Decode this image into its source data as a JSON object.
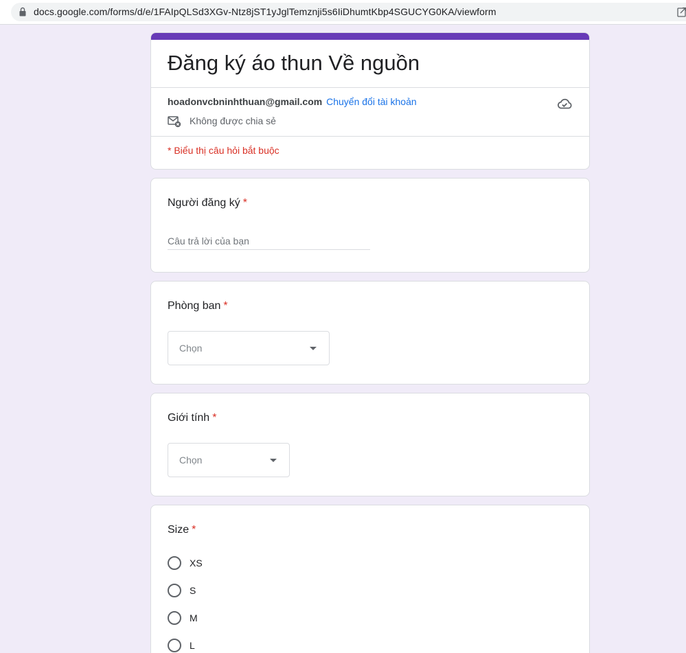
{
  "browser": {
    "url": "docs.google.com/forms/d/e/1FAIpQLSd3XGv-Ntz8jST1yJglTemznji5s6IiDhumtKbp4SGUCYG0KA/viewform",
    "lock_icon": "lock-icon",
    "share_icon": "share-icon"
  },
  "colors": {
    "accent": "#673ab7",
    "background": "#f0ebf8",
    "required": "#d93025",
    "link": "#1a73e8"
  },
  "header": {
    "title": "Đăng ký áo thun Về nguồn",
    "account_email": "hoadonvcbninhthuan@gmail.com",
    "switch_account": "Chuyển đổi tài khoản",
    "not_shared": "Không được chia sẻ",
    "required_note": "* Biểu thị câu hỏi bắt buộc",
    "cloud_icon": "cloud-done-icon",
    "mail_icon": "mail-off-icon"
  },
  "questions": {
    "q1": {
      "title": "Người đăng ký",
      "required_mark": "*",
      "placeholder": "Câu trả lời của bạn"
    },
    "q2": {
      "title": "Phòng ban",
      "required_mark": "*",
      "selected": "Chọn"
    },
    "q3": {
      "title": "Giới tính",
      "required_mark": "*",
      "selected": "Chọn"
    },
    "q4": {
      "title": "Size",
      "required_mark": "*",
      "options": [
        "XS",
        "S",
        "M",
        "L"
      ]
    }
  }
}
